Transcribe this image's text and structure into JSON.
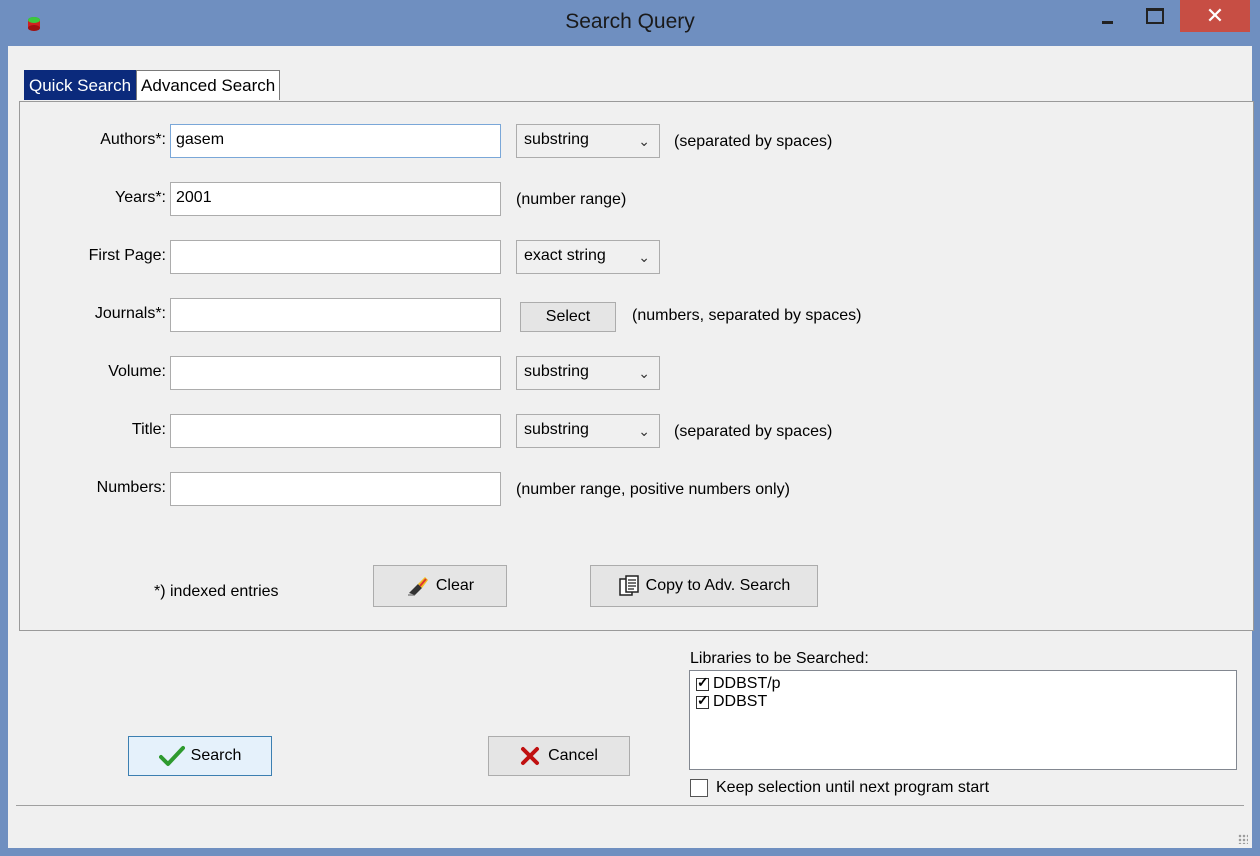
{
  "window": {
    "title": "Search Query"
  },
  "tabs": [
    {
      "label": "Quick Search"
    },
    {
      "label": "Advanced Search"
    }
  ],
  "fields": {
    "authors": {
      "label": "Authors*:",
      "value": "gasem",
      "mode": "substring",
      "hint": "(separated by spaces)"
    },
    "years": {
      "label": "Years*:",
      "value": "2001",
      "hint": "(number range)"
    },
    "first_page": {
      "label": "First Page:",
      "value": "",
      "mode": "exact string"
    },
    "journals": {
      "label": "Journals*:",
      "value": "",
      "button": "Select",
      "hint": "(numbers, separated by spaces)"
    },
    "volume": {
      "label": "Volume:",
      "value": "",
      "mode": "substring"
    },
    "title": {
      "label": "Title:",
      "value": "",
      "mode": "substring",
      "hint": "(separated by spaces)"
    },
    "numbers": {
      "label": "Numbers:",
      "value": "",
      "hint": "(number range, positive numbers only)"
    }
  },
  "footnote": "*) indexed entries",
  "buttons": {
    "clear": "Clear",
    "copy": "Copy to Adv. Search",
    "search": "Search",
    "cancel": "Cancel"
  },
  "libraries": {
    "title": "Libraries to be Searched:",
    "items": [
      {
        "label": "DDBST/p",
        "checked": true
      },
      {
        "label": "DDBST",
        "checked": true
      }
    ],
    "keep_label": "Keep selection until next program start",
    "keep_checked": false
  }
}
